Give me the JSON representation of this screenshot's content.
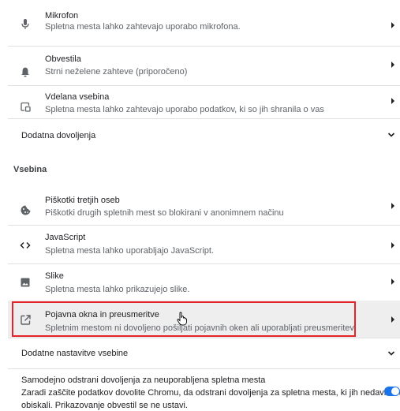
{
  "permissions": [
    {
      "icon": "microphone-icon",
      "title": "Mikrofon",
      "subtitle": "Spletna mesta lahko zahtevajo uporabo mikrofona."
    },
    {
      "icon": "bell-icon",
      "title": "Obvestila",
      "subtitle": "Strni neželene zahteve (priporočeno)"
    },
    {
      "icon": "embedded-content-icon",
      "title": "Vdelana vsebina",
      "subtitle": "Spletna mesta lahko zahtevajo uporabo podatkov, ki so jih shranila o vas"
    }
  ],
  "additional_permissions_label": "Dodatna dovoljenja",
  "content_section_title": "Vsebina",
  "content": [
    {
      "icon": "cookie-icon",
      "title": "Piškotki tretjih oseb",
      "subtitle": "Piškotki drugih spletnih mest so blokirani v anonimnem načinu"
    },
    {
      "icon": "code-icon",
      "title": "JavaScript",
      "subtitle": "Spletna mesta lahko uporabljajo JavaScript."
    },
    {
      "icon": "image-icon",
      "title": "Slike",
      "subtitle": "Spletna mesta lahko prikazujejo slike."
    },
    {
      "icon": "open-in-new-icon",
      "title": "Pojavna okna in preusmeritve",
      "subtitle": "Spletnim mestom ni dovoljeno pošiljati pojavnih oken ali uporabljati preusmeritev."
    }
  ],
  "additional_content_label": "Dodatne nastavitve vsebine",
  "auto_remove": {
    "title": "Samodejno odstrani dovoljenja za neuporabljena spletna mesta",
    "subtitle_line1": "Zaradi zaščite podatkov dovolite Chromu, da odstrani dovoljenja za spletna mesta, ki jih nedavno niste",
    "subtitle_line2": "obiskali. Prikazovanje obvestil se ne ustavi."
  },
  "colors": {
    "accent": "#1a73e8",
    "highlight_border": "#e3242b",
    "highlight_bg": "#eeeeee"
  }
}
